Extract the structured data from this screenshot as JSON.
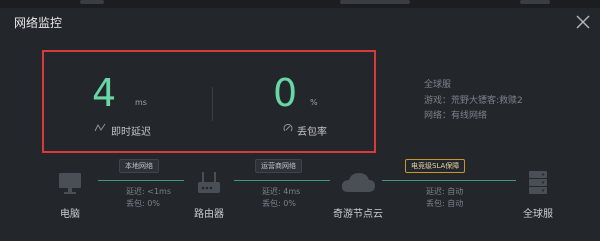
{
  "window": {
    "title": "网络监控"
  },
  "latency": {
    "value": "4",
    "unit": "ms",
    "label": "即时延迟"
  },
  "packet_loss": {
    "value": "0",
    "unit": "%",
    "label": "丢包率"
  },
  "server_info": {
    "header": "全球服",
    "game_label": "游戏：",
    "game_value": "荒野大镖客:救赎2",
    "network_label": "网络：",
    "network_value": "有线网络"
  },
  "route": {
    "nodes": [
      {
        "label": "电脑"
      },
      {
        "label": "路由器"
      },
      {
        "label": "奇游节点云"
      },
      {
        "label": "全球服"
      }
    ],
    "links": [
      {
        "tag": "本地网络",
        "latency_label": "延迟:",
        "latency_value": "<1ms",
        "loss_label": "丢包:",
        "loss_value": "0%"
      },
      {
        "tag": "运营商网络",
        "latency_label": "延迟:",
        "latency_value": "4ms",
        "loss_label": "丢包:",
        "loss_value": "0%"
      },
      {
        "tag": "电竞级SLA保障",
        "latency_label": "延迟:",
        "latency_value": "自动",
        "loss_label": "丢包:",
        "loss_value": "自动"
      }
    ]
  },
  "colors": {
    "accent": "#67d7a5",
    "highlight_border": "#d63a3a",
    "sla_gold": "#c9952d"
  }
}
